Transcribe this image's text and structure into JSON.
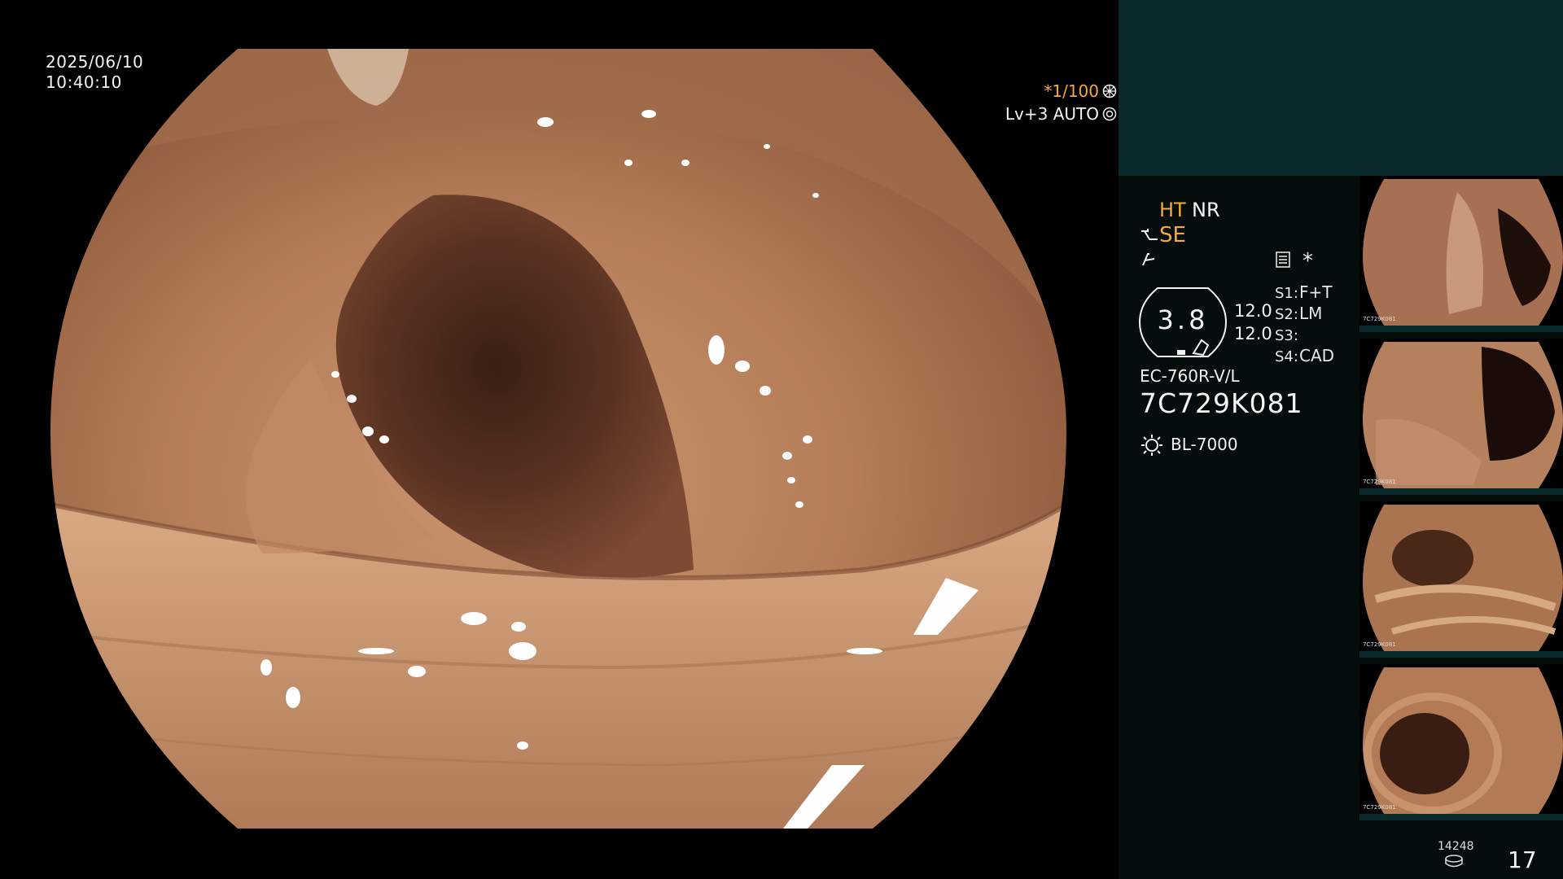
{
  "osd": {
    "date": "2025/06/10",
    "time": "10:40:10",
    "shutter": "*1/100",
    "iris": "Lv+3 AUTO"
  },
  "info_panel": {
    "mode1_a": "HT",
    "mode1_b": "NR",
    "mode2": "SE",
    "star": "*",
    "zoom": "3.8",
    "val1": "12.0",
    "val2": "12.0",
    "s1_label": "S1:",
    "s1_value": "F+T",
    "s2_label": "S2:",
    "s2_value": "LM",
    "s3_label": "S3:",
    "s3_value": "",
    "s4_label": "S4:",
    "s4_value": "CAD",
    "scope_model": "EC-760R-V/L",
    "scope_serial": "7C729K081",
    "light_source": "BL-7000"
  },
  "thumbnails": [
    {
      "caption": "7C729K081"
    },
    {
      "caption": "7C729K081"
    },
    {
      "caption": "7C729K081"
    },
    {
      "caption": "7C729K081"
    }
  ],
  "footer": {
    "storage_count": "14248",
    "image_count": "17"
  },
  "colors": {
    "panel_top": "#0b2a2c",
    "panel_bg": "#050c0c",
    "accent_orange": "#f4a93a",
    "tissue_base": "#b97f5c"
  }
}
